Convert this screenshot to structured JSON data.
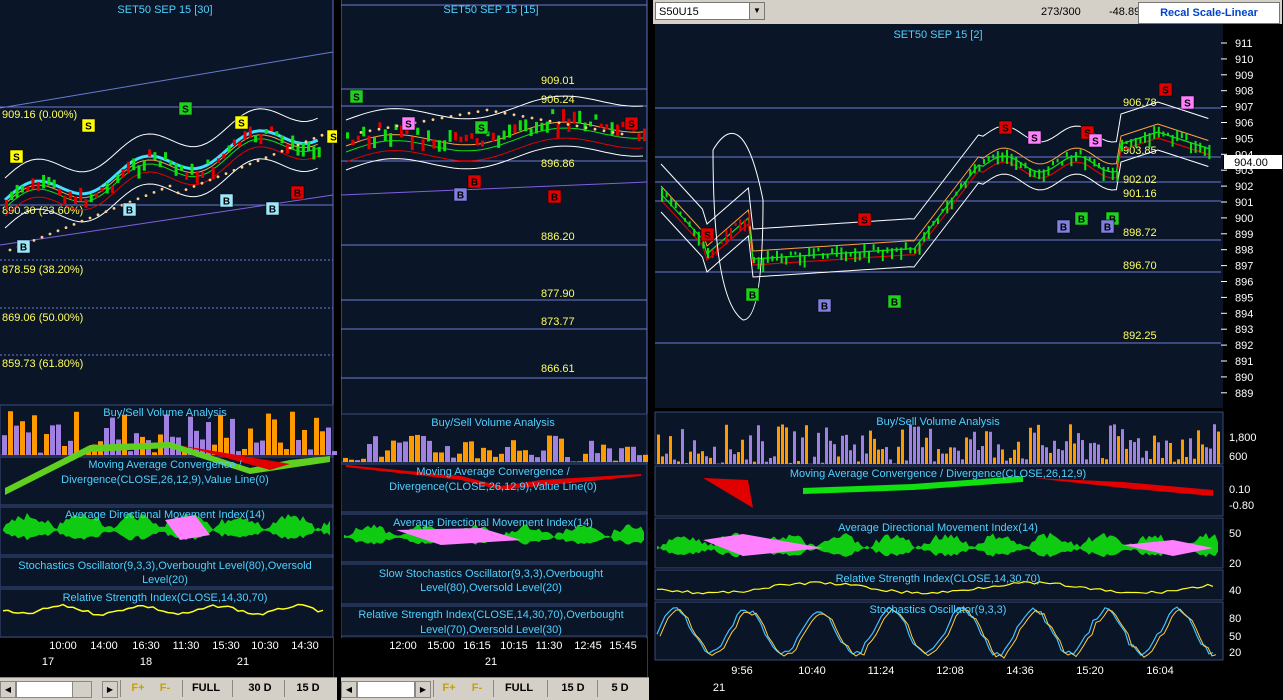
{
  "colors": {
    "bg": "#0a1628",
    "grid": "#2a3a6a",
    "hline": "#6a7ad0",
    "text_cyan": "#4fd0ff",
    "text_yellow": "#ffff60",
    "green": "#10e010",
    "red": "#e00000",
    "pink": "#ff80ff",
    "purple": "#a080e0",
    "orange": "#ff9900"
  },
  "panel1": {
    "title": "SET50 SEP 15  [30]",
    "price_labels": [
      "909.16 (0.00%)",
      "890.30 (23.60%)",
      "878.59 (38.20%)",
      "869.06 (50.00%)",
      "859.73 (61.80%)"
    ],
    "indicators": [
      "Buy/Sell Volume Analysis",
      "Moving Average Convergence / Divergence(CLOSE,26,12,9),Value Line(0)",
      "Average Directional Movement Index(14)",
      "Stochastics Oscillator(9,3,3),Overbought Level(80),Oversold Level(20)",
      "Relative Strength Index(CLOSE,14,30,70)"
    ],
    "time_labels": [
      "10:00",
      "14:00",
      "16:30",
      "11:30",
      "15:30",
      "10:30",
      "14:30"
    ],
    "date_labels": [
      "17",
      "18",
      "21"
    ],
    "buttons": {
      "fplus": "F+",
      "fminus": "F-",
      "full": "FULL",
      "d30": "30 D",
      "d15": "15 D"
    },
    "signals": [
      "S",
      "S",
      "S",
      "S",
      "B",
      "B",
      "B",
      "B",
      "B"
    ]
  },
  "panel2": {
    "title": "SET50 SEP 15  [15]",
    "price_labels": [
      "909.01",
      "906.24",
      "896.86",
      "886.20",
      "877.90",
      "873.77",
      "866.61"
    ],
    "indicators": [
      "Buy/Sell Volume Analysis",
      "Moving Average Convergence / Divergence(CLOSE,26,12,9),Value Line(0)",
      "Average Directional Movement Index(14)",
      "Slow Stochastics Oscillator(9,3,3),Overbought Level(80),Oversold Level(20)",
      "Relative Strength Index(CLOSE,14,30,70),Overbought Level(70),Oversold Level(30)"
    ],
    "time_labels": [
      "12:00",
      "15:00",
      "16:15",
      "10:15",
      "11:30",
      "12:45",
      "15:45"
    ],
    "date_labels": [
      "21"
    ],
    "buttons": {
      "fplus": "F+",
      "fminus": "F-",
      "full": "FULL",
      "d15": "15 D",
      "d5": "5 D"
    },
    "signals": [
      "S",
      "S",
      "S",
      "B",
      "B",
      "B"
    ]
  },
  "panel3": {
    "symbol": "S50U15",
    "count": "273/300",
    "change": "-48.89",
    "recal": "Recal Scale-Linear",
    "title": "SET50 SEP 15  [2]",
    "current_price": "904.00",
    "price_labels": [
      "906.78",
      "903.85",
      "902.02",
      "901.16",
      "898.72",
      "896.70",
      "892.25"
    ],
    "y_axis": [
      "911",
      "910",
      "909",
      "908",
      "907",
      "906",
      "905",
      "904",
      "903",
      "902",
      "901",
      "900",
      "899",
      "898",
      "897",
      "896",
      "895",
      "894",
      "893",
      "892",
      "891",
      "890",
      "889"
    ],
    "indicators": [
      "Buy/Sell Volume Analysis",
      "Moving Average Convergence / Divergence(CLOSE,26,12,9)",
      "Average Directional Movement Index(14)",
      "Relative Strength Index(CLOSE,14,30,70)",
      "Stochastics Oscillator(9,3,3)"
    ],
    "vol_axis": [
      "1,800",
      "600"
    ],
    "macd_axis": [
      "0.10",
      "-0.80"
    ],
    "adx_axis": [
      "50",
      "20"
    ],
    "rsi_axis": [
      "40"
    ],
    "stoch_axis": [
      "80",
      "50",
      "20"
    ],
    "time_labels": [
      "9:56",
      "10:40",
      "11:24",
      "12:08",
      "14:36",
      "15:20",
      "16:04"
    ],
    "date_labels": [
      "21"
    ],
    "signals": [
      "S",
      "S",
      "S",
      "S",
      "S",
      "S",
      "S",
      "B",
      "B",
      "B",
      "B",
      "B",
      "B",
      "B",
      "B"
    ]
  }
}
